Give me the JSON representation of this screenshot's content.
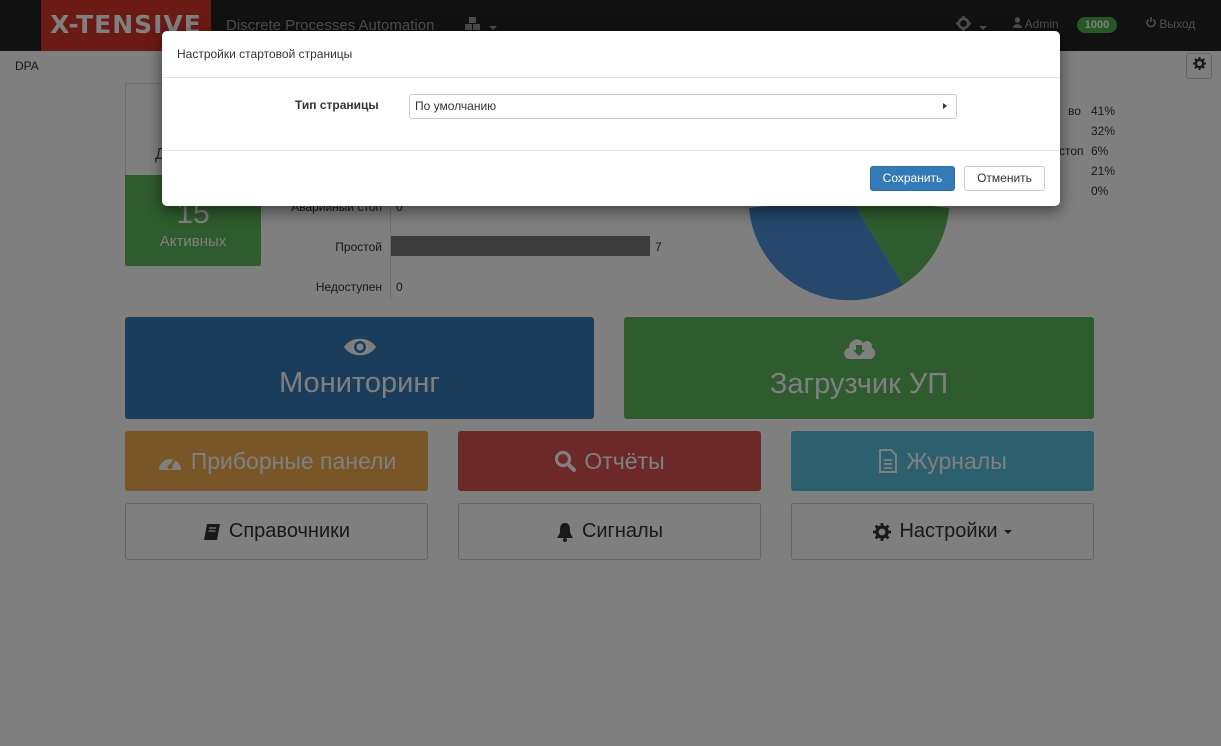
{
  "navbar": {
    "brand": "X-TENSIVE",
    "app_title": "Discrete Processes Automation",
    "user": "Admin",
    "badge": "1000",
    "logout": "Выход"
  },
  "breadcrumb": "DPA",
  "summary": {
    "active_count": "15",
    "active_label": "Активных",
    "partial_letter": "Д"
  },
  "status_bars": [
    {
      "label": "Аварийный стоп",
      "value": 0
    },
    {
      "label": "Простой",
      "value": 7
    },
    {
      "label": "Недоступен",
      "value": 0
    }
  ],
  "pie_legend": {
    "labels": [
      "во",
      "",
      "стоп",
      "",
      ""
    ],
    "percents": [
      "41%",
      "32%",
      "6%",
      "21%",
      "0%"
    ]
  },
  "tiles": {
    "monitoring": "Мониторинг",
    "loader": "Загрузчик УП",
    "dashboards": "Приборные панели",
    "reports": "Отчёты",
    "journals": "Журналы",
    "references": "Справочники",
    "signals": "Сигналы",
    "settings": "Настройки"
  },
  "modal": {
    "title": "Настройки стартовой страницы",
    "field_label": "Тип страницы",
    "select_value": "По умолчанию",
    "save": "Сохранить",
    "cancel": "Отменить"
  },
  "colors": {
    "brand": "#d9342b",
    "blue": "#337ab7",
    "green": "#5cb85c",
    "orange": "#f0ad4e",
    "red": "#d9534f",
    "cyan": "#5bc0de"
  }
}
